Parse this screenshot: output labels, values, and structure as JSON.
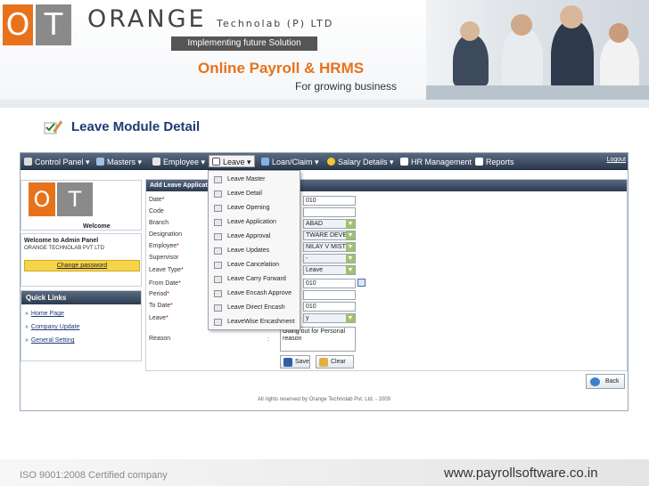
{
  "slide": {
    "logo_o": "O",
    "logo_t": "T",
    "company_name": "ORANGE",
    "company_suffix": "Technolab (P) LTD",
    "tagline": "Implementing future Solution",
    "product_title": "Online Payroll & HRMS",
    "product_subtitle": "For growing business",
    "section_title": "Leave Module Detail",
    "footer_iso": "ISO 9001:2008 Certified company",
    "footer_url": "www.payrollsoftware.co.in",
    "colors": {
      "orange": "#e8721c",
      "navy": "#1f3b73",
      "nav_dark": "#2c3a4f"
    }
  },
  "nav": {
    "items": [
      {
        "label": "Control Panel ▾",
        "icon": "wrench-icon"
      },
      {
        "label": "Masters ▾",
        "icon": "masters-icon"
      },
      {
        "label": "Employee ▾",
        "icon": "employee-icon"
      },
      {
        "label": "Leave ▾",
        "icon": "leave-icon"
      },
      {
        "label": "Loan/Claim ▾",
        "icon": "loan-icon"
      },
      {
        "label": "Salary Details ▾",
        "icon": "coin-icon"
      },
      {
        "label": "HR Management",
        "icon": "hr-icon"
      },
      {
        "label": "Reports",
        "icon": "reports-icon"
      }
    ],
    "logout": "Logout"
  },
  "leave_menu": [
    "Leave Master",
    "Leave Detail",
    "Leave Opening",
    "Leave Application",
    "Leave Approval",
    "Leave Updates",
    "Leave Cancelation",
    "Leave Carry Forward",
    "Leave Encash Approve",
    "Leave Direct Encash",
    "LeaveWise Encashment"
  ],
  "sidebar": {
    "welcome": "Welcome",
    "admin_title": "Welcome to Admin Panel",
    "admin_company": "ORANGE TECHNOLAB PVT LTD",
    "change_password": "Change password",
    "quick_links_title": "Quick Links",
    "quick_links": [
      "Home Page",
      "Company Update",
      "General Setting"
    ]
  },
  "form": {
    "header": "Add Leave Application",
    "fields": [
      {
        "label": "Date",
        "required": "*",
        "value": "010"
      },
      {
        "label": "Code",
        "required": "",
        "value": ""
      },
      {
        "label": "Branch",
        "required": "",
        "value": "ABAD"
      },
      {
        "label": "Designation",
        "required": "",
        "value": "TWARE DEVE"
      },
      {
        "label": "Employee",
        "required": "*",
        "value": "NILAY V MISTI"
      },
      {
        "label": "Supervisor",
        "required": "",
        "value": "-"
      },
      {
        "label": "Leave Type",
        "required": "*",
        "value": "Leave"
      },
      {
        "label": "From Date",
        "required": "*",
        "value": "010"
      },
      {
        "label": "Period",
        "required": "*",
        "value": ""
      },
      {
        "label": "To Date",
        "required": "*",
        "value": "010"
      },
      {
        "label": "Leave",
        "required": "*",
        "value": "y"
      }
    ],
    "reason_label": "Reason",
    "reason_colon": ":",
    "reason_value": "Going out for Personal reason",
    "save_label": "Save",
    "clear_label": "Clear"
  },
  "back_label": "Back",
  "app_footer": "All rights reserved by Orange Technolab Pvt. Ltd. - 2009"
}
